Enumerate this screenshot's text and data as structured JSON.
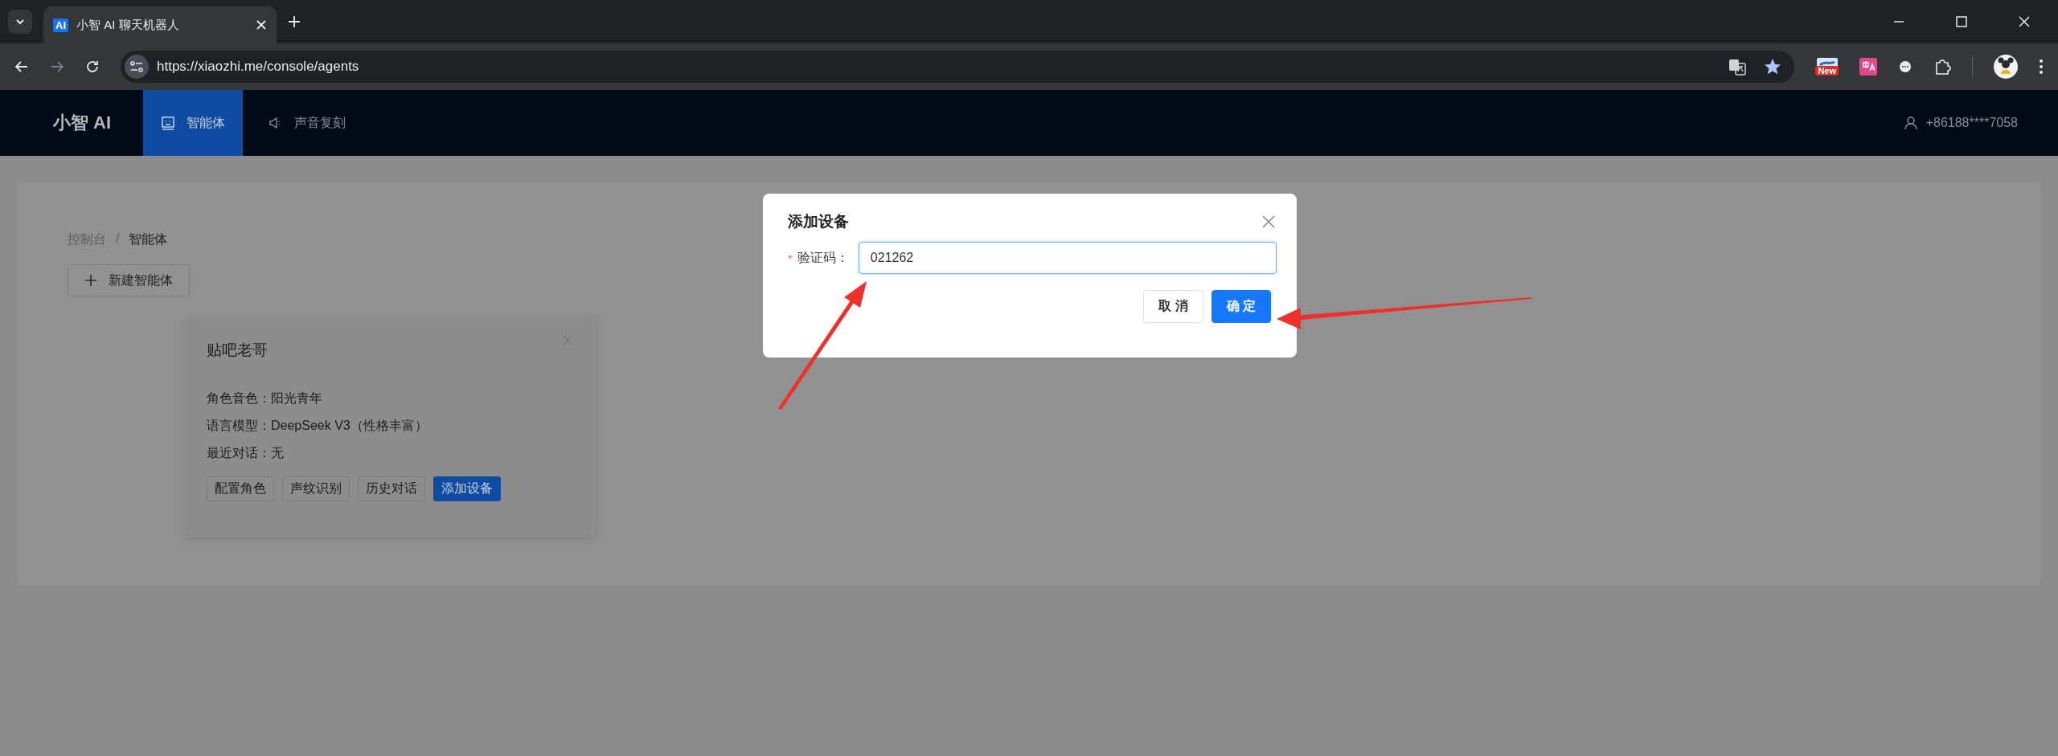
{
  "browser": {
    "tab": {
      "favicon": "AI",
      "title": "小智 AI 聊天机器人"
    },
    "url": "https://xiaozhi.me/console/agents",
    "extension_badge": "New"
  },
  "nav": {
    "logo": "小智 AI",
    "items": [
      {
        "label": "智能体",
        "selected": true
      },
      {
        "label": "声音复刻",
        "selected": false
      }
    ],
    "user": "+86188****7058"
  },
  "breadcrumb": {
    "items": [
      "控制台",
      "智能体"
    ],
    "separator": "/"
  },
  "new_button": "新建智能体",
  "agent_card": {
    "title": "贴吧老哥",
    "fields": [
      {
        "label": "角色音色：",
        "value": "阳光青年"
      },
      {
        "label": "语言模型：",
        "value": "DeepSeek V3（性格丰富）"
      },
      {
        "label": "最近对话：",
        "value": "无"
      }
    ],
    "actions": [
      {
        "label": "配置角色",
        "kind": "default"
      },
      {
        "label": "声纹识别",
        "kind": "default"
      },
      {
        "label": "历史对话",
        "kind": "default"
      },
      {
        "label": "添加设备",
        "kind": "primary"
      }
    ]
  },
  "dialog": {
    "title": "添加设备",
    "field": {
      "required_mark": "*",
      "label": "验证码：",
      "value": "021262",
      "focused": true
    },
    "buttons": [
      {
        "label": "取 消",
        "kind": "default"
      },
      {
        "label": "确 定",
        "kind": "primary"
      }
    ]
  }
}
